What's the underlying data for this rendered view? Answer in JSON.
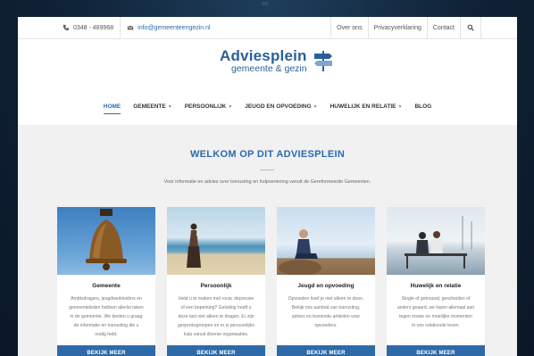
{
  "topbar": {
    "phone": "0348 - 489968",
    "email": "info@gemeenteengezin.nl",
    "links": [
      "Over ons",
      "Privacyverklaring",
      "Contact"
    ]
  },
  "logo": {
    "title": "Adviesplein",
    "subtitle": "gemeente & gezin"
  },
  "nav": {
    "items": [
      {
        "label": "HOME"
      },
      {
        "label": "GEMEENTE"
      },
      {
        "label": "PERSOONLIJK"
      },
      {
        "label": "JEUGD EN OPVOEDING"
      },
      {
        "label": "HUWELIJK EN RELATIE"
      },
      {
        "label": "BLOG"
      }
    ]
  },
  "main": {
    "heading": "WELKOM OP DIT ADVIESPLEIN",
    "intro": "Voor informatie en advies over toerusting en hulpverlening vanuit de Gereformeerde Gemeenten."
  },
  "cards": [
    {
      "title": "Gemeente",
      "lines": [
        "Ambtsdragers, jeugdwerkleiders en",
        "gemeenteleden hebben allerlei taken",
        "in de gemeente. We bieden u graag",
        "de informatie en toerusting die u",
        "nodig hebt."
      ],
      "button": "BEKIJK MEER"
    },
    {
      "title": "Persoonlijk",
      "lines": [
        "Hebt u te maken met rouw, depressie",
        "of een beperking? Gelukkig hoeft u",
        "deze last niet alleen te dragen. Er zijn",
        "gespreksgroepen en er is persoonlijke",
        "hulp vanuit diverse organisaties."
      ],
      "button": "BEKIJK MEER"
    },
    {
      "title": "Jeugd en opvoeding",
      "lines": [
        "Opvoeden hoef je niet alleen te doen.",
        "Bekijk ons aanbod van toerusting,",
        "advies en boeiende artikelen voor",
        "opvoeders."
      ],
      "button": "BEKIJK MEER"
    },
    {
      "title": "Huwelijk en relatie",
      "lines": [
        "Single of getrouwd, gescheiden of",
        "anders geaard, we lopen allemaal aan",
        "tegen moeie en moeilijke momenten",
        "in ons relationele leven."
      ],
      "button": "BEKIJK MEER"
    }
  ],
  "colors": {
    "brand_blue": "#2c5f99",
    "button_blue": "#2e6aa8",
    "page_bg": "#f1f1f1"
  }
}
